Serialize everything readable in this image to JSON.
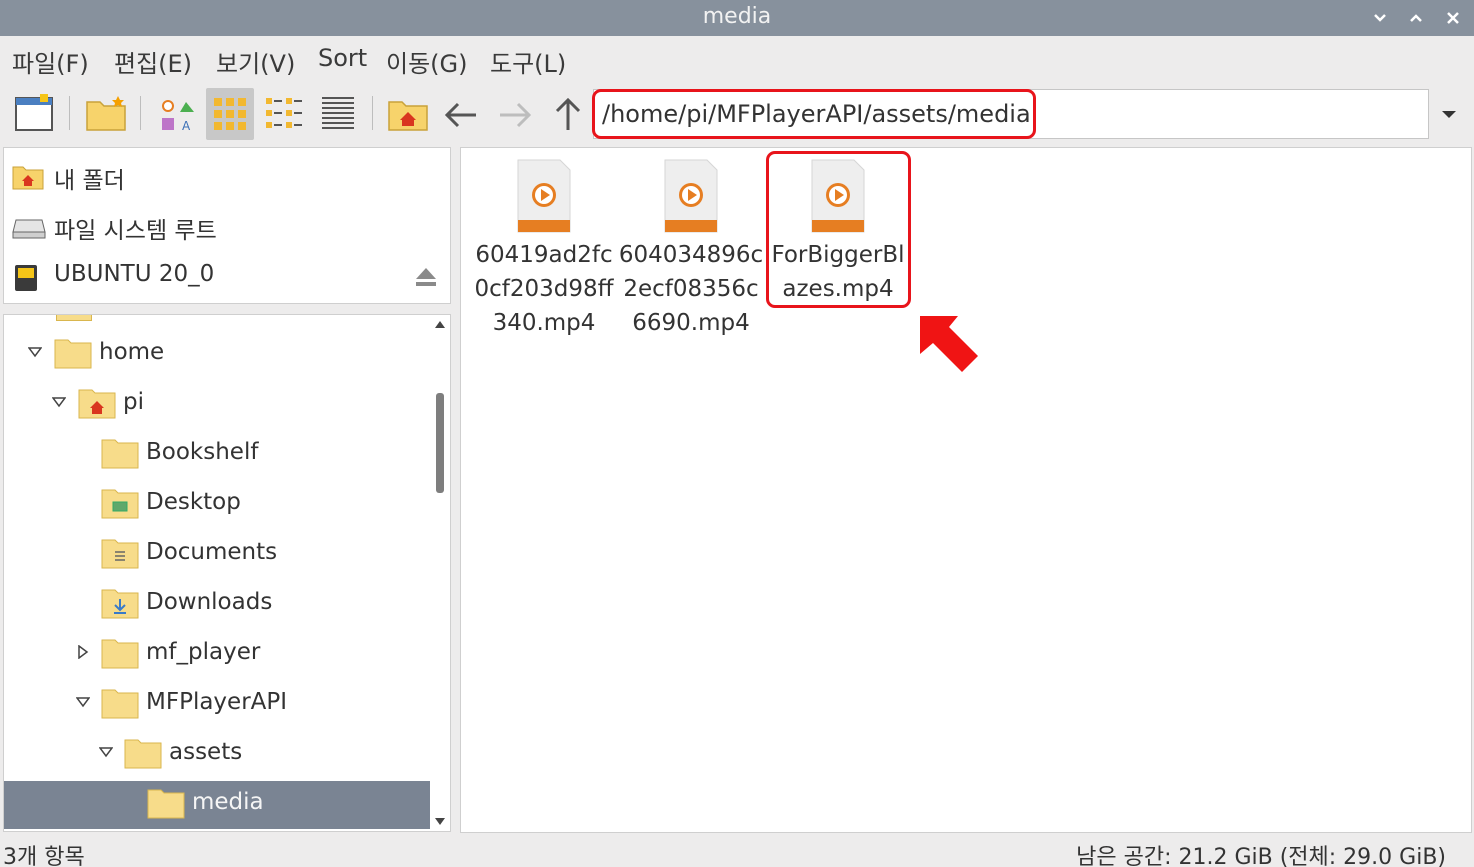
{
  "window": {
    "title": "media",
    "minimize_icon": "chevron-down-icon",
    "maximize_icon": "chevron-up-icon",
    "close_icon": "close-icon"
  },
  "menu": [
    "파일(F)",
    "편집(E)",
    "보기(V)",
    "Sort",
    "이동(G)",
    "도구(L)"
  ],
  "toolbar": {
    "path": "/home/pi/MFPlayerAPI/assets/media",
    "active_view": "icon-view"
  },
  "places": [
    {
      "label": "내 폴더",
      "icon": "home-folder-icon"
    },
    {
      "label": "파일 시스템 루트",
      "icon": "drive-icon"
    },
    {
      "label": "UBUNTU 20_0",
      "icon": "sd-card-icon"
    }
  ],
  "tree": [
    {
      "label": "home",
      "level": 1,
      "expander": "expanded",
      "icon": "folder-icon"
    },
    {
      "label": "pi",
      "level": 2,
      "expander": "expanded",
      "icon": "home-folder-icon"
    },
    {
      "label": "Bookshelf",
      "level": 3,
      "expander": "none",
      "icon": "folder-icon"
    },
    {
      "label": "Desktop",
      "level": 3,
      "expander": "none",
      "icon": "desktop-folder-icon"
    },
    {
      "label": "Documents",
      "level": 3,
      "expander": "none",
      "icon": "documents-folder-icon"
    },
    {
      "label": "Downloads",
      "level": 3,
      "expander": "none",
      "icon": "downloads-folder-icon"
    },
    {
      "label": "mf_player",
      "level": 3,
      "expander": "collapsed",
      "icon": "folder-icon"
    },
    {
      "label": "MFPlayerAPI",
      "level": 3,
      "expander": "expanded",
      "icon": "folder-icon"
    },
    {
      "label": "assets",
      "level": 4,
      "expander": "expanded",
      "icon": "folder-icon"
    },
    {
      "label": "media",
      "level": 5,
      "expander": "none",
      "icon": "folder-icon",
      "selected": true
    }
  ],
  "files": [
    {
      "name": "60419ad2fc0cf203d98ff340.mp4",
      "icon": "video-file-icon"
    },
    {
      "name": "604034896c2ecf08356c6690.mp4",
      "icon": "video-file-icon"
    },
    {
      "name": "ForBiggerBlazes.mp4",
      "icon": "video-file-icon",
      "highlighted": true
    }
  ],
  "status": {
    "items": "3개 항목",
    "free_space": "남은 공간: 21.2 GiB (전체: 29.0 GiB)"
  },
  "colors": {
    "titlebar": "#87919d",
    "highlight": "#e8141b",
    "selection": "#7a8493",
    "folder": "#f7dc8a",
    "video_accent": "#e67e22"
  }
}
